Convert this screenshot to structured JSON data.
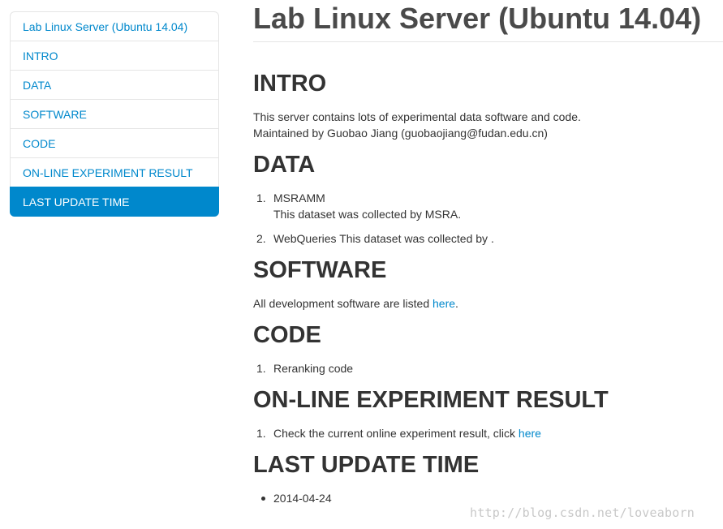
{
  "sidebar": {
    "items": [
      {
        "label": "Lab Linux Server (Ubuntu 14.04)"
      },
      {
        "label": "INTRO"
      },
      {
        "label": "DATA"
      },
      {
        "label": "SOFTWARE"
      },
      {
        "label": "CODE"
      },
      {
        "label": "ON-LINE EXPERIMENT RESULT"
      },
      {
        "label": "LAST UPDATE TIME",
        "active": true
      }
    ]
  },
  "main": {
    "title": "Lab Linux Server (Ubuntu 14.04)",
    "intro": {
      "heading": "INTRO",
      "line1": "This server contains lots of experimental data software and code.",
      "line2": "Maintained by Guobao Jiang (guobaojiang@fudan.edu.cn)"
    },
    "data": {
      "heading": "DATA",
      "items": [
        {
          "marker": "1.",
          "name": "MSRAMM",
          "desc": "This dataset was collected by MSRA."
        },
        {
          "marker": "2.",
          "text": "WebQueries This dataset was collected by ."
        }
      ]
    },
    "software": {
      "heading": "SOFTWARE",
      "text_before": "All development software are listed ",
      "link": "here",
      "text_after": "."
    },
    "code": {
      "heading": "CODE",
      "items": [
        {
          "marker": "1.",
          "text": "Reranking code"
        }
      ]
    },
    "online": {
      "heading": "ON-LINE EXPERIMENT RESULT",
      "items": [
        {
          "marker": "1.",
          "text": "Check the current online experiment result, click ",
          "link": "here"
        }
      ]
    },
    "last_update": {
      "heading": "LAST UPDATE TIME",
      "items": [
        {
          "text": "2014-04-24"
        }
      ]
    }
  },
  "watermark": "http://blog.csdn.net/loveaborn",
  "colors": {
    "link": "#0088cc",
    "active_bg": "#0088cc",
    "text": "#333333",
    "border": "#e5e5e5"
  }
}
